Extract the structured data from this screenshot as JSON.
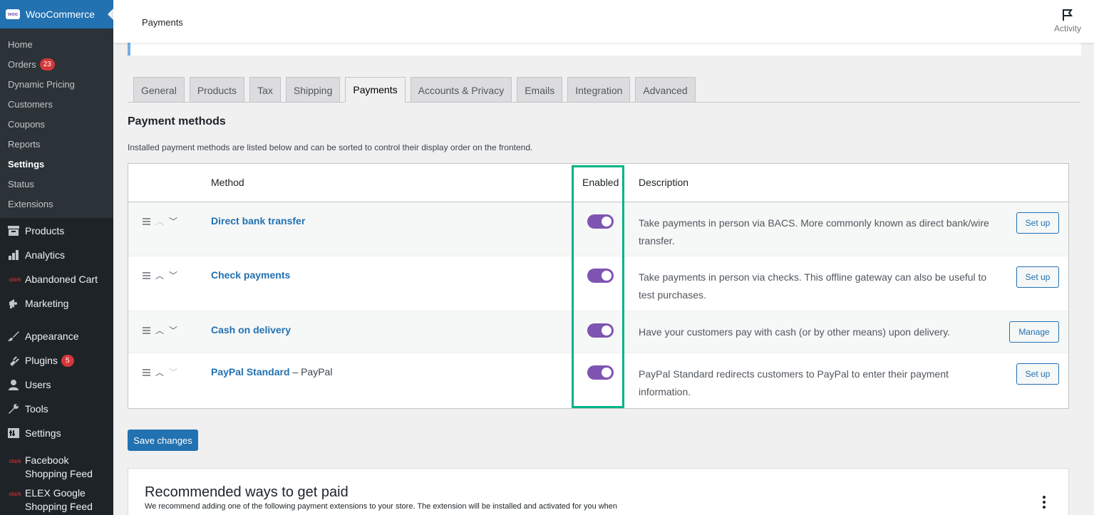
{
  "sidebar": {
    "brand": "WooCommerce",
    "brand_logo": "woo",
    "submenu": [
      {
        "label": "Home"
      },
      {
        "label": "Orders",
        "badge": "23"
      },
      {
        "label": "Dynamic Pricing"
      },
      {
        "label": "Customers"
      },
      {
        "label": "Coupons"
      },
      {
        "label": "Reports"
      },
      {
        "label": "Settings",
        "active": true
      },
      {
        "label": "Status"
      },
      {
        "label": "Extensions"
      }
    ],
    "menu": [
      {
        "label": "Products",
        "icon": "archive-icon"
      },
      {
        "label": "Analytics",
        "icon": "bar-chart-icon"
      },
      {
        "label": "Abandoned Cart",
        "icon": "olark-icon"
      },
      {
        "label": "Marketing",
        "icon": "megaphone-icon"
      },
      {
        "label": "Appearance",
        "icon": "brush-icon"
      },
      {
        "label": "Plugins",
        "icon": "plugin-icon",
        "badge": "5"
      },
      {
        "label": "Users",
        "icon": "users-icon"
      },
      {
        "label": "Tools",
        "icon": "wrench-icon"
      },
      {
        "label": "Settings",
        "icon": "settings-icon"
      },
      {
        "label": "Facebook Shopping Feed",
        "icon": "olark-icon"
      },
      {
        "label": "ELEX Google Shopping Feed",
        "icon": "olark-icon"
      }
    ],
    "olark_text": "olark"
  },
  "topbar": {
    "title": "Payments",
    "activity_label": "Activity"
  },
  "tabs": [
    "General",
    "Products",
    "Tax",
    "Shipping",
    "Payments",
    "Accounts & Privacy",
    "Emails",
    "Integration",
    "Advanced"
  ],
  "active_tab": "Payments",
  "section": {
    "title": "Payment methods",
    "intro": "Installed payment methods are listed below and can be sorted to control their display order on the frontend."
  },
  "table": {
    "headers": {
      "method": "Method",
      "enabled": "Enabled",
      "description": "Description"
    },
    "rows": [
      {
        "method": "Direct bank transfer",
        "extra": "",
        "enabled": true,
        "description": "Take payments in person via BACS. More commonly known as direct bank/wire transfer.",
        "action": "Set up"
      },
      {
        "method": "Check payments",
        "extra": "",
        "enabled": true,
        "description": "Take payments in person via checks. This offline gateway can also be useful to test purchases.",
        "action": "Set up"
      },
      {
        "method": "Cash on delivery",
        "extra": "",
        "enabled": true,
        "description": "Have your customers pay with cash (or by other means) upon delivery.",
        "action": "Manage"
      },
      {
        "method": "PayPal Standard",
        "extra": " – PayPal",
        "enabled": true,
        "description": "PayPal Standard redirects customers to PayPal to enter their payment information.",
        "action": "Set up"
      }
    ]
  },
  "save_label": "Save changes",
  "recommended": {
    "title": "Recommended ways to get paid",
    "desc": "We recommend adding one of the following payment extensions to your store. The extension will be installed and activated for you when"
  },
  "colors": {
    "toggle_on": "#7f54b3",
    "highlight": "#00b386",
    "link": "#2271b1"
  }
}
